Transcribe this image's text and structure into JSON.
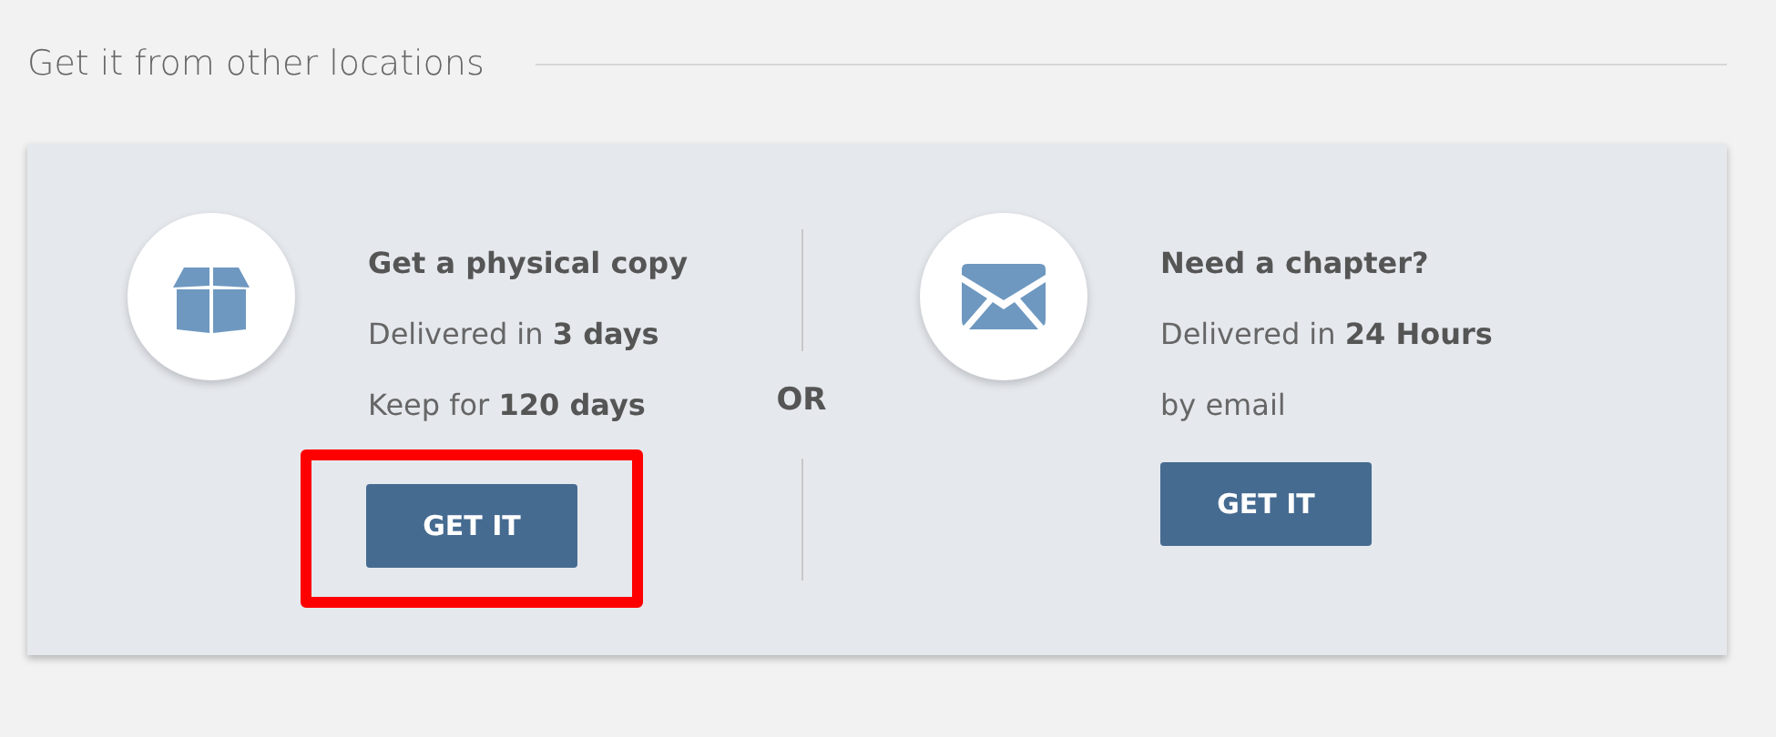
{
  "section": {
    "title": "Get it from other locations"
  },
  "options": [
    {
      "kind": "parcel",
      "title": "Get a physical copy",
      "lines": [
        "Delivered in **3 days**",
        "Keep for **120 days**"
      ],
      "button": "GET IT",
      "highlighted": true
    },
    {
      "kind": "chapter",
      "title": "Need a chapter?",
      "lines": [
        "Delivered in **24 Hours**",
        "by email"
      ],
      "button": "GET IT",
      "highlighted": false
    }
  ],
  "separator": "OR"
}
